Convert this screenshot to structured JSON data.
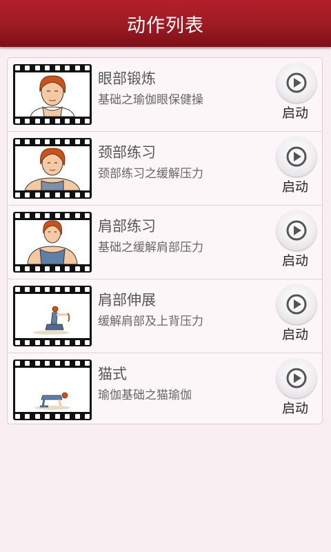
{
  "header": {
    "title": "动作列表"
  },
  "items": [
    {
      "name": "眼部锻炼",
      "desc": "基础之瑜伽眼保健操",
      "action": "启动",
      "figure": "face-closeup"
    },
    {
      "name": "颈部练习",
      "desc": "颈部练习之缓解压力",
      "action": "启动",
      "figure": "face-shoulders"
    },
    {
      "name": "肩部练习",
      "desc": "基础之缓解肩部压力",
      "action": "启动",
      "figure": "torso-tank"
    },
    {
      "name": "肩部伸展",
      "desc": "缓解肩部及上背压力",
      "action": "启动",
      "figure": "seated-stretch"
    },
    {
      "name": "猫式",
      "desc": "瑜伽基础之猫瑜伽",
      "action": "启动",
      "figure": "cat-pose"
    }
  ],
  "colors": {
    "header_bg": "#9c1a23",
    "page_bg": "#f9eef1",
    "play_icon": "#555555"
  }
}
